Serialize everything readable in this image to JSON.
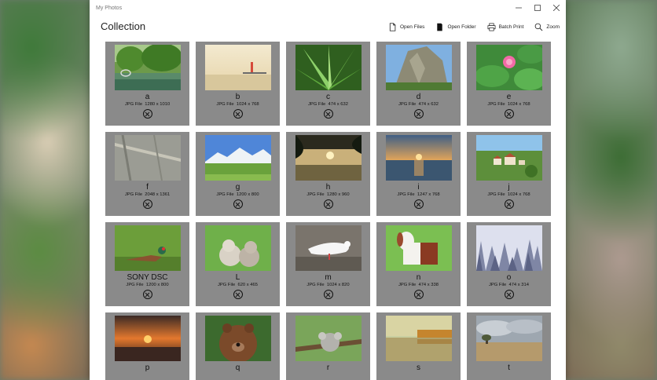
{
  "window": {
    "title": "My Photos"
  },
  "header": {
    "title": "Collection"
  },
  "toolbar": {
    "open_files": "Open Files",
    "open_folder": "Open Folder",
    "batch_print": "Batch Print",
    "zoom": "Zoom"
  },
  "photos": [
    {
      "name": "a",
      "meta": "JPG File  1280 x 1010",
      "scene": "park-pond"
    },
    {
      "name": "b",
      "meta": "JPG File  1024 x 768",
      "scene": "pier-sea"
    },
    {
      "name": "c",
      "meta": "JPG File  474 x 632",
      "scene": "green-leaves"
    },
    {
      "name": "d",
      "meta": "JPG File  474 x 632",
      "scene": "rock-mountain"
    },
    {
      "name": "e",
      "meta": "JPG File  1024 x 768",
      "scene": "lotus"
    },
    {
      "name": "f",
      "meta": "JPG File  2048 x 1361",
      "scene": "cliff-trail"
    },
    {
      "name": "g",
      "meta": "JPG File  1200 x 800",
      "scene": "snowy-meadow"
    },
    {
      "name": "h",
      "meta": "JPG File  1280 x 960",
      "scene": "lake-sunset"
    },
    {
      "name": "i",
      "meta": "JPG File  1247 x 768",
      "scene": "sea-sunset"
    },
    {
      "name": "j",
      "meta": "JPG File  1024 x 768",
      "scene": "village"
    },
    {
      "name": "SONY DSC",
      "meta": "JPG File  1200 x 800",
      "scene": "pheasant"
    },
    {
      "name": "L",
      "meta": "JPG File  620 x 465",
      "scene": "kittens"
    },
    {
      "name": "m",
      "meta": "JPG File  1024 x 820",
      "scene": "dove"
    },
    {
      "name": "n",
      "meta": "JPG File  474 x 338",
      "scene": "goat"
    },
    {
      "name": "o",
      "meta": "JPG File  474 x 314",
      "scene": "misty-forest"
    },
    {
      "name": "p",
      "meta": "",
      "scene": "orange-sunset"
    },
    {
      "name": "q",
      "meta": "",
      "scene": "bear"
    },
    {
      "name": "r",
      "meta": "",
      "scene": "koala"
    },
    {
      "name": "s",
      "meta": "",
      "scene": "autumn-lake"
    },
    {
      "name": "t",
      "meta": "",
      "scene": "cloudy-field"
    }
  ],
  "icons": {
    "open_files": "file-icon",
    "open_folder": "folder-icon",
    "batch_print": "printer-icon",
    "zoom": "magnifier-icon",
    "remove": "circle-x-icon"
  }
}
